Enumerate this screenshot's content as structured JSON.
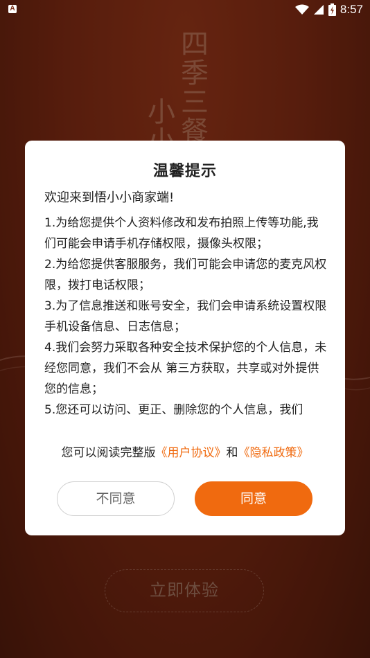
{
  "status_bar": {
    "app_icon_letter": "A",
    "time": "8:57",
    "icons": [
      "wifi-icon",
      "signal-icon",
      "battery-charging-icon"
    ]
  },
  "background": {
    "slogan_line_1": "四季三餐",
    "slogan_line_2": "小小",
    "experience_button_label": "立即体验"
  },
  "dialog": {
    "title": "温馨提示",
    "greeting": "欢迎来到悟小小商家端!",
    "items": [
      "1.为给您提供个人资料修改和发布拍照上传等功能,我们可能会申请手机存储权限，摄像头权限；",
      "2.为给您提供客服服务，我们可能会申请您的麦克风权限，拨打电话权限；",
      "3.为了信息推送和账号安全，我们会申请系统设置权限手机设备信息、日志信息；",
      "4.我们会努力采取各种安全技术保护您的个人信息，未经您同意，我们不会从 第三方获取，共享或对外提供您的信息；",
      "5.您还可以访问、更正、删除您的个人信息，我们"
    ],
    "links_prefix": "您可以阅读完整版",
    "user_agreement_link": "《用户协议》",
    "links_conjunction": "和",
    "privacy_policy_link": "《隐私政策》",
    "disagree_label": "不同意",
    "agree_label": "同意"
  },
  "colors": {
    "accent": "#f06a0f",
    "background": "#8c2f15"
  }
}
